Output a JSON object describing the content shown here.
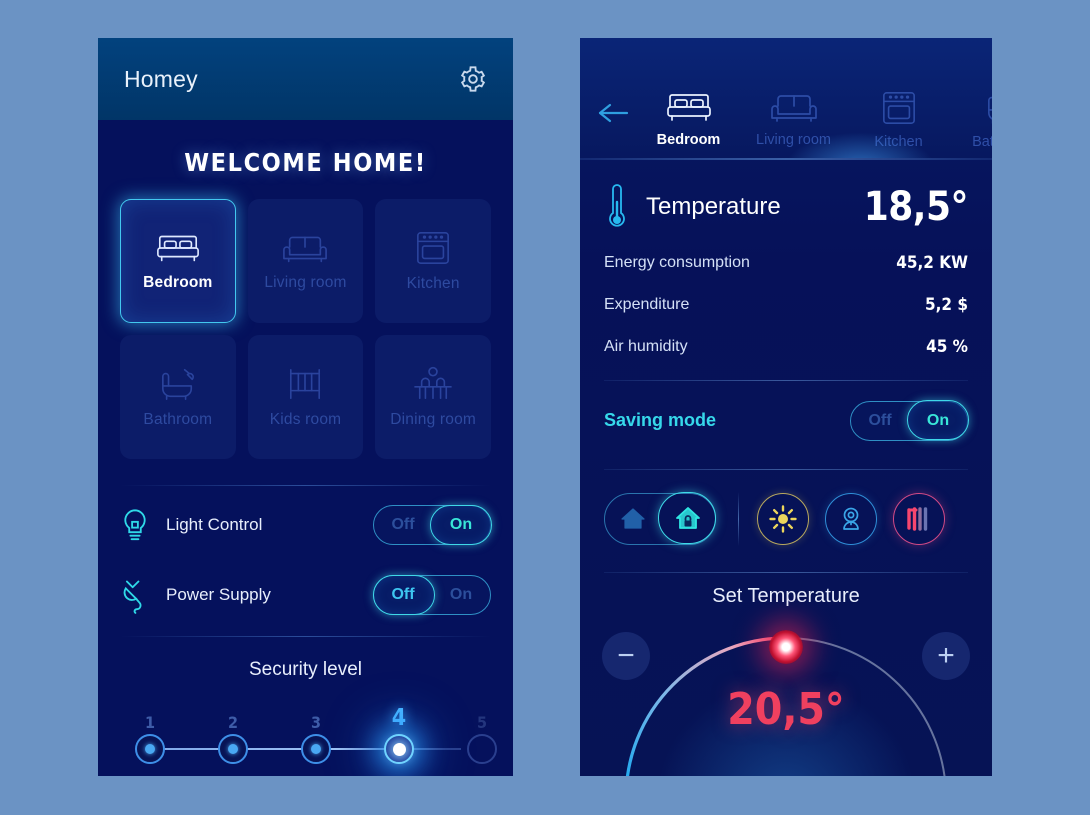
{
  "background_color": "#6b93c4",
  "left_phone": {
    "header": {
      "title": "Homey",
      "settings_icon": "gear-icon"
    },
    "welcome": "WELCOME HOME!",
    "rooms": [
      {
        "label": "Bedroom",
        "icon": "bed-icon",
        "active": true
      },
      {
        "label": "Living room",
        "icon": "sofa-icon",
        "active": false
      },
      {
        "label": "Kitchen",
        "icon": "oven-icon",
        "active": false
      },
      {
        "label": "Bathroom",
        "icon": "bathtub-icon",
        "active": false
      },
      {
        "label": "Kids room",
        "icon": "crib-icon",
        "active": false
      },
      {
        "label": "Dining room",
        "icon": "dining-icon",
        "active": false
      }
    ],
    "controls": [
      {
        "label": "Light Control",
        "icon": "lightbulb-icon",
        "off_label": "Off",
        "on_label": "On",
        "state": "on"
      },
      {
        "label": "Power Supply",
        "icon": "plug-icon",
        "off_label": "Off",
        "on_label": "On",
        "state": "off"
      }
    ],
    "security": {
      "title": "Security level",
      "levels": [
        "1",
        "2",
        "3",
        "4",
        "5"
      ],
      "current": "4"
    }
  },
  "right_phone": {
    "back_icon": "back-arrow-icon",
    "tabs": [
      {
        "label": "Bedroom",
        "icon": "bed-icon",
        "active": true
      },
      {
        "label": "Living room",
        "icon": "sofa-icon",
        "active": false
      },
      {
        "label": "Kitchen",
        "icon": "oven-icon",
        "active": false
      },
      {
        "label": "Bathroom",
        "icon": "bathtub-icon",
        "active": false
      }
    ],
    "temperature": {
      "icon": "thermometer-icon",
      "label": "Temperature",
      "value": "18,5°"
    },
    "stats": [
      {
        "label": "Energy consumption",
        "value": "45,2 KW"
      },
      {
        "label": "Expenditure",
        "value": "5,2 $"
      },
      {
        "label": "Air humidity",
        "value": "45 %"
      }
    ],
    "saving_mode": {
      "label": "Saving mode",
      "off_label": "Off",
      "on_label": "On",
      "state": "on"
    },
    "mode_toggle": {
      "inactive_icon": "house-icon",
      "active_icon": "house-lock-icon"
    },
    "quick_actions": [
      {
        "icon": "sun-icon",
        "color": "#e8cf5a"
      },
      {
        "icon": "camera-icon",
        "color": "#3aa0e0"
      },
      {
        "icon": "heater-icon",
        "color": "#f0486e"
      }
    ],
    "set_temperature": {
      "title": "Set Temperature",
      "value": "20,5°",
      "minus_label": "−",
      "plus_label": "+",
      "accent_color": "#f0405f"
    }
  }
}
